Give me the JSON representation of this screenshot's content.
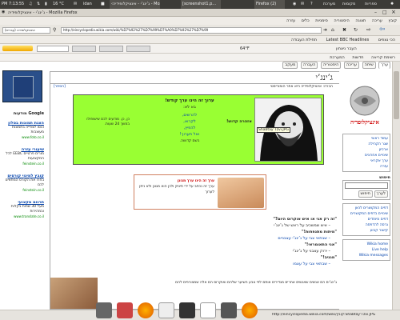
{
  "topbar": {
    "time": "PM 7:13:55",
    "weather": "16 °C",
    "user": "idan",
    "tasks": [
      "‹ג’ינג’י - אינציקלופידיה - Mozilla Firefox",
      "[screenshot1.p...",
      "Firefox (2)"
    ],
    "menus": [
      "ספריות",
      "מקומות",
      "מערכת"
    ]
  },
  "window": {
    "title": "ג’ינג’י - אינציקלופידיה - Mozilla Firefox",
    "menu": [
      "קובץ",
      "עריכה",
      "תצוגה",
      "היסטוריה",
      "סימניות",
      "כלים",
      "עזרה"
    ],
    "url": "http://eincyclopedia.wikia.com/wiki/%D7%92%27%D7%99%D7%A0%D7%92%27%D7%99",
    "search_placeholder": "אינציקלופדיה (עברית)",
    "bookmarks": [
      "הכי נצפים",
      "Latest BBC Headlines",
      "תחילת העבודה"
    ],
    "toolbar2": [
      "64°F",
      "העבר ניצחון"
    ],
    "toolbar3": [
      "רשימת קריאה",
      "חדשות",
      "המערכת"
    ]
  },
  "wiki": {
    "logo_text": "אינציקלופדיה",
    "tabs": [
      "ערך",
      "שיחה",
      "עריכה",
      "היסטוריה",
      "העברה",
      "מעקב"
    ],
    "page_title": "ג’ינג’י",
    "subtitle": "הברה: אינציקלופדיה היא אתר הומוריסטי",
    "hide_link": "[הסתר]",
    "nav_items": [
      "עמוד ראשי",
      "שגר הקהילה",
      "ארכיון",
      "שינויים אחרונים",
      "ערך אקראי",
      "עזרה"
    ],
    "search_label": "חיפוש",
    "search_buttons": [
      "לערך",
      "חיפוש"
    ],
    "tool_items": [
      "דפים המקושרים לכאן",
      "שינויים בדפים המקושרים",
      "דפים מיוחדים",
      "גרסה להדפסה",
      "קישור קבוע"
    ],
    "wikia_items": [
      "Wikia home",
      "Live help",
      "Wikia messages"
    ],
    "infobox_title": "ערוך זה הינו ערך קודש!",
    "infobox_sub": "בא לא:",
    "infobox_list": [
      "להרשים,",
      "לקרוא,",
      "להפיץ,",
      "ואל תערוך!"
    ],
    "infobox_side": "אזהרה קדוש!",
    "infobox_note": "כן, כן. מודעים לכם שישופולו במשך 24 שעות.",
    "infobox_sign": "בשם קדושה.",
    "image_caption": "Shabtay’Tzvi.JPG",
    "notice_title": "ערך זה הינו ערך מגונן",
    "notice_text": "ערך זה נכתב על ידי תינוק ולכן הוא מגונן ולא ניתן לערוך",
    "quotes": [
      "\"זה רק אני או איש אוקרוס היום?\"",
      "– איש שמשכיב על ראש של ג’ינג’י",
      "\"מיתות מתנפחות!\"",
      "– שבתאי צבי על ג’ינג’י עצבניים",
      "\"אני התאומראי!\"",
      "– ירוק עצבני על ג’ינג’י",
      "\"מגניב!\"",
      "– שבתאי צבי על עצמו"
    ],
    "body_text": "ג’ינג’ים הם אנשים שאנשים אחרים מגדירים אותם לפי צבע השיער שלהם ואוקרוס הם אלה שמצורפים להם"
  },
  "left_ads": {
    "google_label": "Google מודעות",
    "ads": [
      {
        "title": "הצגת תמונות בסלון",
        "body": "כנסו לצפייה בתמונות מעוצבות",
        "url": "www.foto.co.il"
      },
      {
        "title": "שיעורי עזרה",
        "body": "מורים פרטיים EEBC לכל המקצועות",
        "url": "feinstein.co.il"
      },
      {
        "title": "קובץ למינוי קורסים",
        "body": "בחרו את הקורס המתאים לכם",
        "url": "feinstein.co.il"
      },
      {
        "title": "תרגום מקצועי",
        "body": "מעל 30 שפות בקלות ובמהירות",
        "url": "www.translate.co.il"
      }
    ]
  },
  "status": {
    "url": "http://eincyclopedia.wikia.com/wiki/קובץ:Shabtay'Tzvi.JPG"
  },
  "colors": {
    "gnome_panel": "#3c3b37",
    "infobox_green": "#99ff33",
    "notice_border": "#d08060",
    "link_blue": "#0645ad",
    "red_title": "#cc0000"
  }
}
